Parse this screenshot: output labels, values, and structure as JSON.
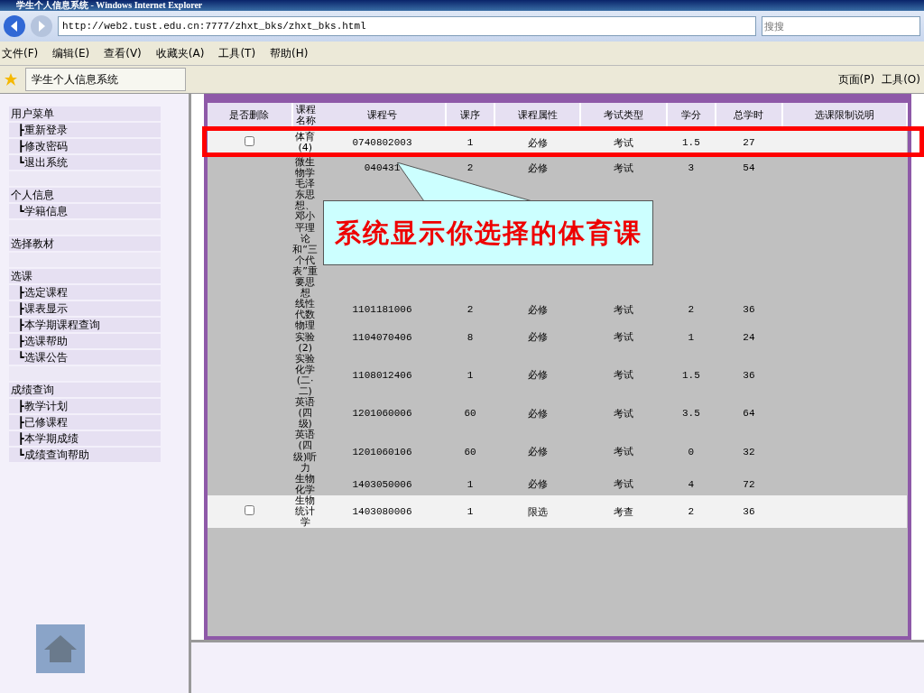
{
  "window": {
    "title": "学生个人信息系统 - Windows Internet Explorer"
  },
  "address_bar": {
    "url": "http://web2.tust.edu.cn:7777/zhxt_bks/zhxt_bks.html"
  },
  "search": {
    "placeholder": "搜搜"
  },
  "menu": [
    "文件(F)",
    "编辑(E)",
    "查看(V)",
    "收藏夹(A)",
    "工具(T)",
    "帮助(H)"
  ],
  "tab": {
    "title": "学生个人信息系统",
    "selected": true
  },
  "command_bar": [
    "页面(P)",
    "工具(O)"
  ],
  "sidebar": {
    "groups": [
      {
        "title": "用户菜单",
        "items": [
          "┣重新登录",
          "┣修改密码",
          "┗退出系统"
        ]
      },
      {
        "title": "个人信息",
        "items": [
          "┗学籍信息"
        ]
      },
      {
        "title": "选择教材"
      },
      {
        "title": "选课",
        "items": [
          "┣选定课程",
          "┣课表显示",
          "┣本学期课程查询",
          "┣选课帮助",
          "┗选课公告"
        ]
      },
      {
        "title": "成绩查询",
        "items": [
          "┣教学计划",
          "┣已修课程",
          "┣本学期成绩",
          "┗成绩查询帮助"
        ]
      }
    ]
  },
  "table": {
    "columns": [
      "是否删除",
      "课程名称",
      "课程号",
      "课序",
      "课程属性",
      "考试类型",
      "学分",
      "总学时",
      "选课限制说明"
    ],
    "rows": [
      {
        "kind": "deletable",
        "checked": false,
        "cells": [
          "",
          "体育(4)",
          "0740802003",
          "1",
          "必修",
          "考试",
          "1.5",
          "27"
        ]
      },
      {
        "kind": "locked",
        "cells": [
          "",
          "微生物学",
          "040431",
          "2",
          "必修",
          "考试",
          "3",
          "54"
        ]
      },
      {
        "kind": "locked",
        "cells": [
          "",
          "毛泽东思想、邓小平理论和“三个代表”重要思想"
        ]
      },
      {
        "kind": "locked",
        "cells": [
          "",
          "线性代数",
          "1101181006",
          "2",
          "必修",
          "考试",
          "2",
          "36"
        ]
      },
      {
        "kind": "locked",
        "cells": [
          "",
          "物理实验(2)",
          "1104070406",
          "8",
          "必修",
          "考试",
          "1",
          "24"
        ]
      },
      {
        "kind": "locked",
        "cells": [
          "",
          "实验化学(二·二)",
          "1108012406",
          "1",
          "必修",
          "考试",
          "1.5",
          "36"
        ]
      },
      {
        "kind": "locked",
        "cells": [
          "",
          "英语(四级)",
          "1201060006",
          "60",
          "必修",
          "考试",
          "3.5",
          "64"
        ]
      },
      {
        "kind": "locked",
        "cells": [
          "",
          "英语(四级)听力",
          "1201060106",
          "60",
          "必修",
          "考试",
          "0",
          "32"
        ]
      },
      {
        "kind": "locked",
        "cells": [
          "",
          "生物化学",
          "1403050006",
          "1",
          "必修",
          "考试",
          "4",
          "72"
        ]
      },
      {
        "kind": "deletable",
        "checked": false,
        "cells": [
          "",
          "生物统计学",
          "1403080006",
          "1",
          "限选",
          "考查",
          "2",
          "36"
        ]
      }
    ]
  },
  "callout": {
    "text": "系统显示你选择的体育课"
  }
}
